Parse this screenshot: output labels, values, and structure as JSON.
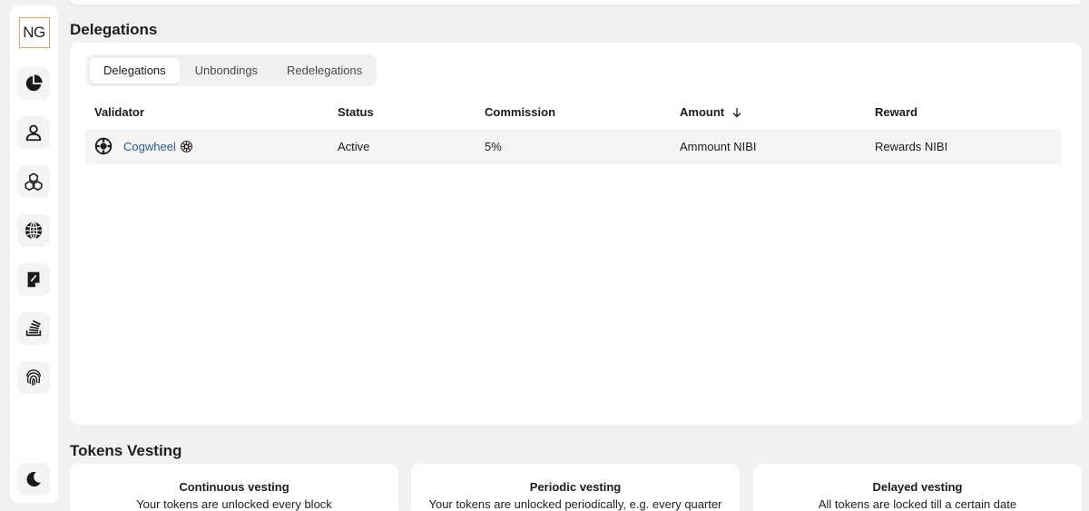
{
  "sidebar": {
    "logo_text": "NG",
    "items": [
      {
        "icon": "pie-chart-icon"
      },
      {
        "icon": "user-icon"
      },
      {
        "icon": "cubes-icon"
      },
      {
        "icon": "globe-icon"
      },
      {
        "icon": "document-icon"
      },
      {
        "icon": "stack-icon"
      },
      {
        "icon": "fingerprint-icon"
      }
    ],
    "bottom_icon": "moon-icon"
  },
  "delegations": {
    "section_title": "Delegations",
    "tabs": [
      {
        "label": "Delegations",
        "active": true
      },
      {
        "label": "Unbondings",
        "active": false
      },
      {
        "label": "Redelegations",
        "active": false
      }
    ],
    "columns": {
      "validator": "Validator",
      "status": "Status",
      "commission": "Commission",
      "amount": "Amount",
      "reward": "Reward"
    },
    "rows": [
      {
        "validator": "Cogwheel",
        "status": "Active",
        "commission": "5%",
        "amount": "Ammount NIBI",
        "reward": "Rewards NIBI"
      }
    ]
  },
  "vesting": {
    "section_title": "Tokens Vesting",
    "cards": [
      {
        "title": "Continuous vesting",
        "desc": "Your tokens are unlocked every block"
      },
      {
        "title": "Periodic vesting",
        "desc": "Your tokens are unlocked periodically, e.g. every quarter"
      },
      {
        "title": "Delayed vesting",
        "desc": "All tokens are locked till a certain date"
      }
    ]
  },
  "colors": {
    "background": "#f1f1f1",
    "card": "#ffffff",
    "link": "#2a5a8a",
    "logo_border": "#d6a46b"
  }
}
